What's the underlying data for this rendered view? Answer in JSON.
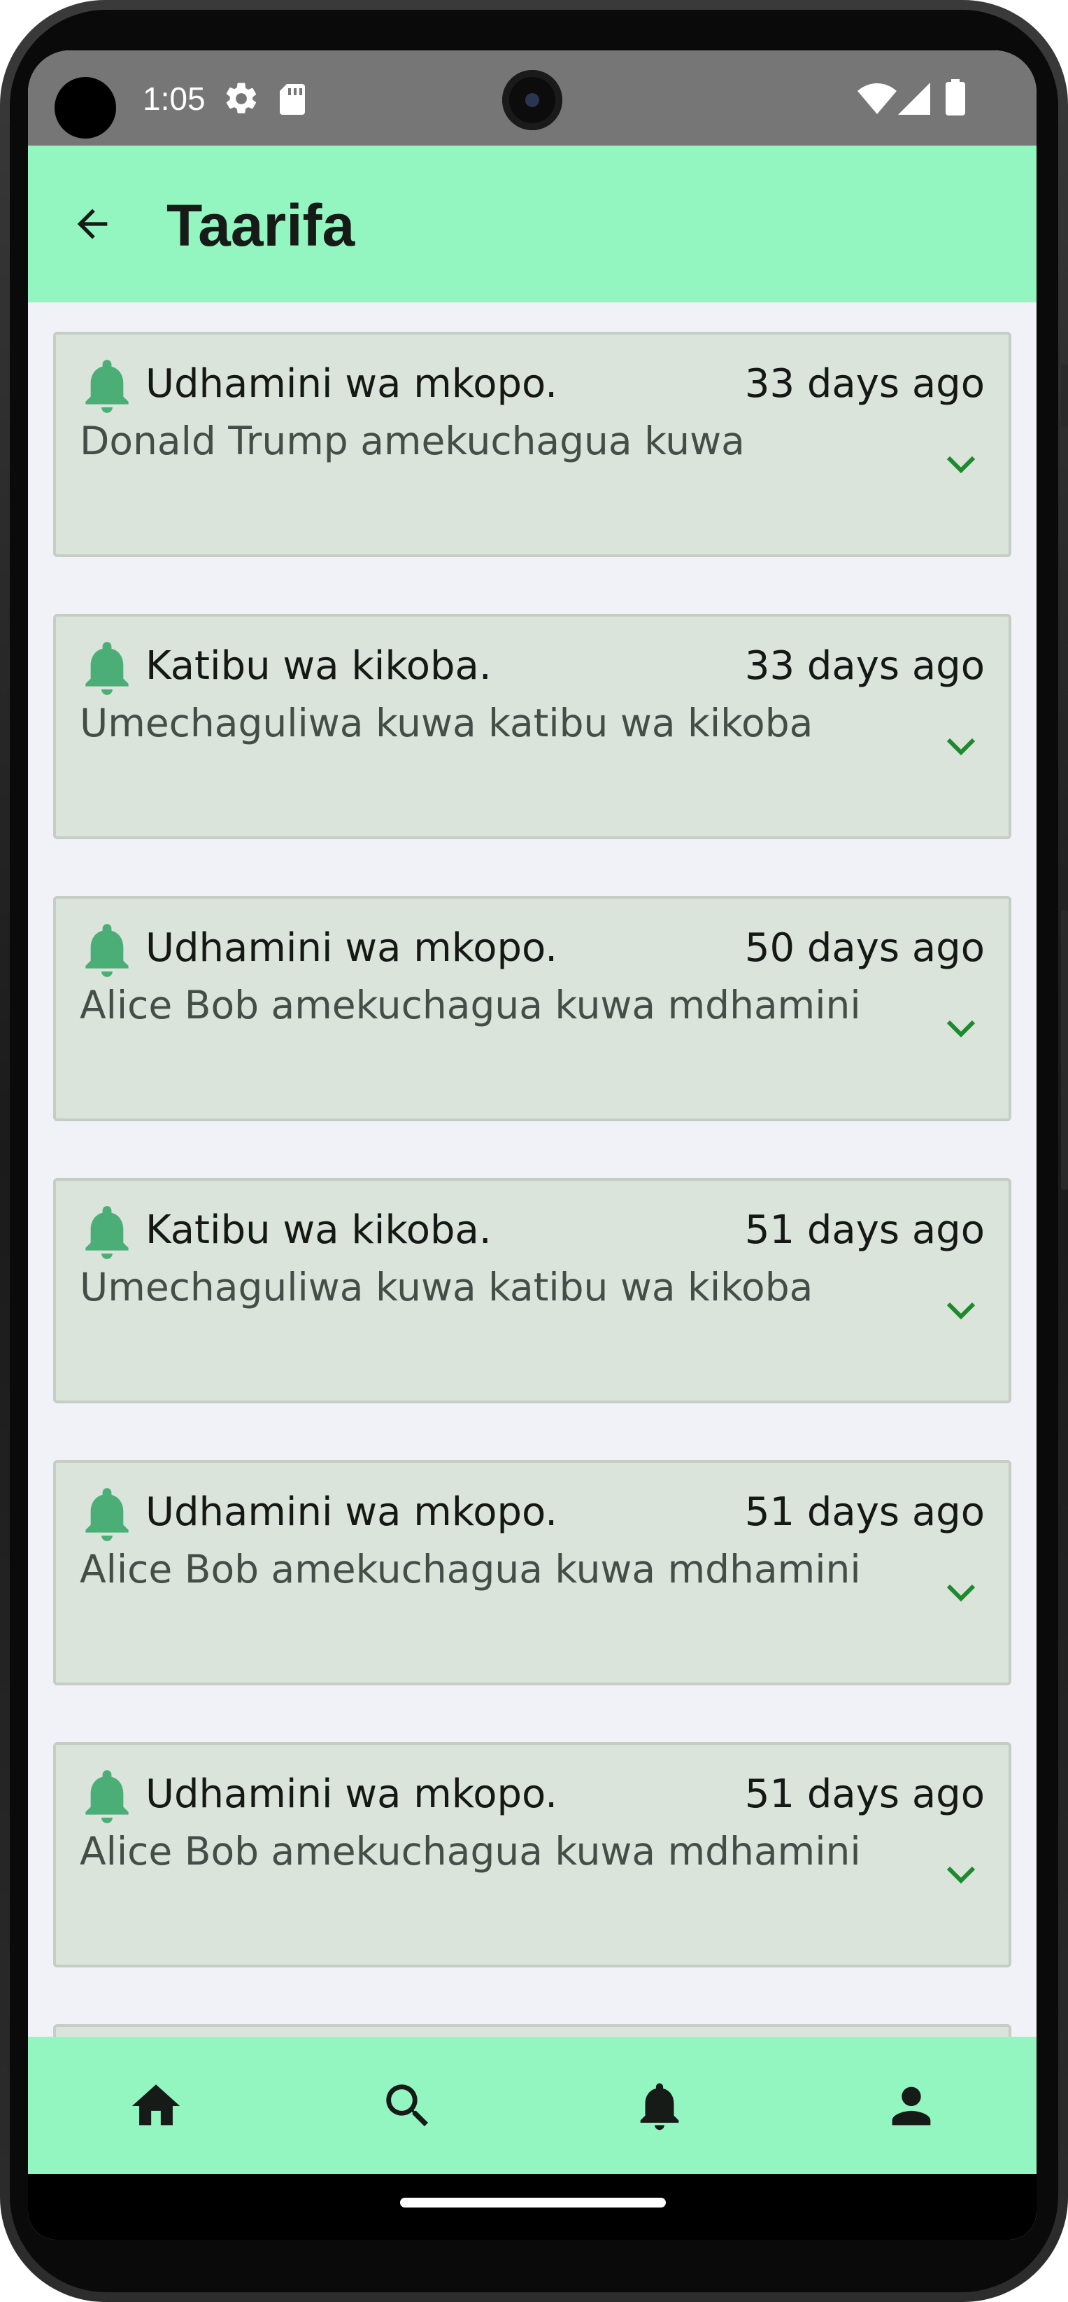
{
  "status_bar": {
    "time": "1:05",
    "icons": [
      "settings-gear-icon",
      "sd-card-icon",
      "wifi-icon",
      "cell-signal-icon",
      "battery-icon"
    ]
  },
  "app_bar": {
    "title": "Taarifa",
    "back_icon": "arrow-back-icon"
  },
  "colors": {
    "accent": "#93f6c1",
    "card_background": "#dae4da",
    "bell": "#4cae77",
    "chevron": "#1e8a2e"
  },
  "notifications": [
    {
      "title": "Udhamini wa mkopo.",
      "time": "33 days ago",
      "body": "Donald Trump amekuchagua kuwa"
    },
    {
      "title": "Katibu wa kikoba.",
      "time": "33 days ago",
      "body": "Umechaguliwa kuwa katibu wa kikoba"
    },
    {
      "title": "Udhamini wa mkopo.",
      "time": "50 days ago",
      "body": "Alice Bob amekuchagua kuwa mdhamini"
    },
    {
      "title": "Katibu wa kikoba.",
      "time": "51 days ago",
      "body": "Umechaguliwa kuwa katibu wa kikoba"
    },
    {
      "title": "Udhamini wa mkopo.",
      "time": "51 days ago",
      "body": "Alice Bob amekuchagua kuwa mdhamini"
    },
    {
      "title": "Udhamini wa mkopo.",
      "time": "51 days ago",
      "body": "Alice Bob amekuchagua kuwa mdhamini"
    }
  ],
  "bottom_nav": {
    "items": [
      {
        "icon": "home-icon"
      },
      {
        "icon": "search-icon"
      },
      {
        "icon": "bell-icon"
      },
      {
        "icon": "person-icon"
      }
    ]
  }
}
